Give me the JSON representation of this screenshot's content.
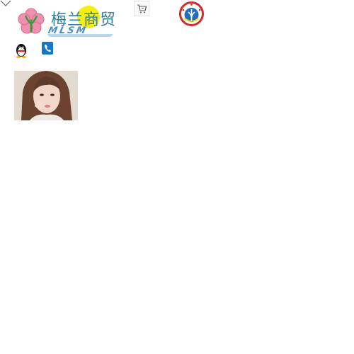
{
  "header": {
    "logo_text": "梅兰商贸",
    "logo_sub": "MLSM",
    "colors": {
      "logo_text": "#2f7fa0",
      "flower": "#f08fb0",
      "sun": "#f5ee10",
      "badge_red": "#d42a2a",
      "badge_blue": "#1f6fc0"
    }
  },
  "icons": {
    "menu_toggle": "chevron-down-icon",
    "cart": "shopping-cart-icon",
    "badge": "emblem-badge-icon",
    "qq": "qq-penguin-icon",
    "phone": "phone-icon"
  },
  "profile": {
    "photo": "profile-photo"
  }
}
